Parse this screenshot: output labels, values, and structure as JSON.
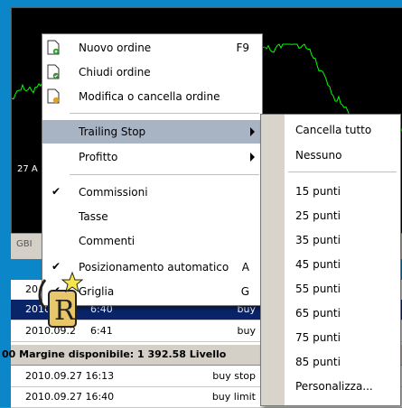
{
  "chart": {
    "x_label": "27 A"
  },
  "tabs": {
    "symbol_tab": "GBI"
  },
  "terminal": {
    "header_time": "20",
    "rows": [
      {
        "time": "2010.09.",
        "time2": "6:40",
        "type": "buy",
        "selected": true
      },
      {
        "time": "2010.09.2",
        "time2": "6:41",
        "type": "buy",
        "selected": false
      }
    ],
    "summary": "00  Margine disponibile: 1 392.58  Livello",
    "rows2": [
      {
        "time": "2010.09.27 16:13",
        "type": "buy stop"
      },
      {
        "time": "2010.09.27 16:40",
        "type": "buy limit"
      }
    ]
  },
  "menu": {
    "new_order": {
      "label": "Nuovo ordine",
      "shortcut": "F9",
      "icon": "new-order-icon"
    },
    "close_order": {
      "label": "Chiudi ordine",
      "icon": "close-order-icon"
    },
    "modify_order": {
      "label": "Modifica o cancella ordine",
      "icon": "modify-order-icon"
    },
    "trailing_stop": {
      "label": "Trailing Stop"
    },
    "profit": {
      "label": "Profitto"
    },
    "commissions": {
      "label": "Commissioni",
      "checked": true
    },
    "taxes": {
      "label": "Tasse"
    },
    "comments": {
      "label": "Commenti"
    },
    "auto_arrange": {
      "label": "Posizionamento  automatico",
      "shortcut": "A",
      "checked": true
    },
    "grid": {
      "label": "Griglia",
      "shortcut": "G",
      "checked": true
    }
  },
  "submenu": {
    "items": [
      "Cancella tutto",
      "Nessuno",
      "15 punti",
      "25 punti",
      "35 punti",
      "45 punti",
      "55 punti",
      "65 punti",
      "75 punti",
      "85 punti",
      "Personalizza..."
    ]
  },
  "colors": {
    "highlight": "#a8b3c4",
    "selected_row": "#0a246a",
    "chart_line": "#00ff00",
    "frame": "#0a86c9"
  }
}
